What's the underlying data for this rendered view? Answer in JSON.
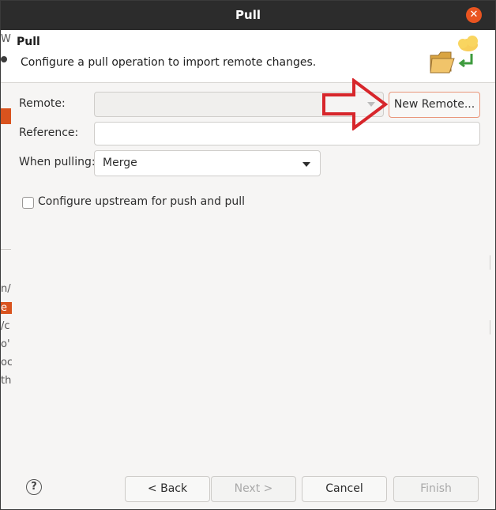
{
  "dialog": {
    "title": "Pull",
    "close_icon": "close-icon"
  },
  "banner": {
    "title": "Pull",
    "description": "Configure a pull operation to import remote changes.",
    "icon": "folder-cloud-pull-icon"
  },
  "form": {
    "remote_label": "Remote:",
    "remote_value": "",
    "new_remote_button": "New Remote...",
    "reference_label": "Reference:",
    "reference_value": "",
    "when_pulling_label": "When pulling:",
    "when_pulling_value": "Merge",
    "upstream_checkbox_label": "Configure upstream for push and pull",
    "upstream_checked": false
  },
  "footer": {
    "help_icon": "help-icon",
    "back_button": "< Back",
    "next_button": "Next >",
    "cancel_button": "Cancel",
    "finish_button": "Finish"
  },
  "background_fragments": {
    "top": "W",
    "line1": "n/",
    "line2": "e",
    "line3": "/c",
    "line4": "o'",
    "line5": "oc",
    "line6": "th"
  },
  "annotation": {
    "arrow_color": "#d7262b",
    "icon": "red-outline-arrow-icon"
  },
  "colors": {
    "titlebar": "#2c2c2c",
    "close_button": "#e95420",
    "focus_border": "#e9967a"
  }
}
